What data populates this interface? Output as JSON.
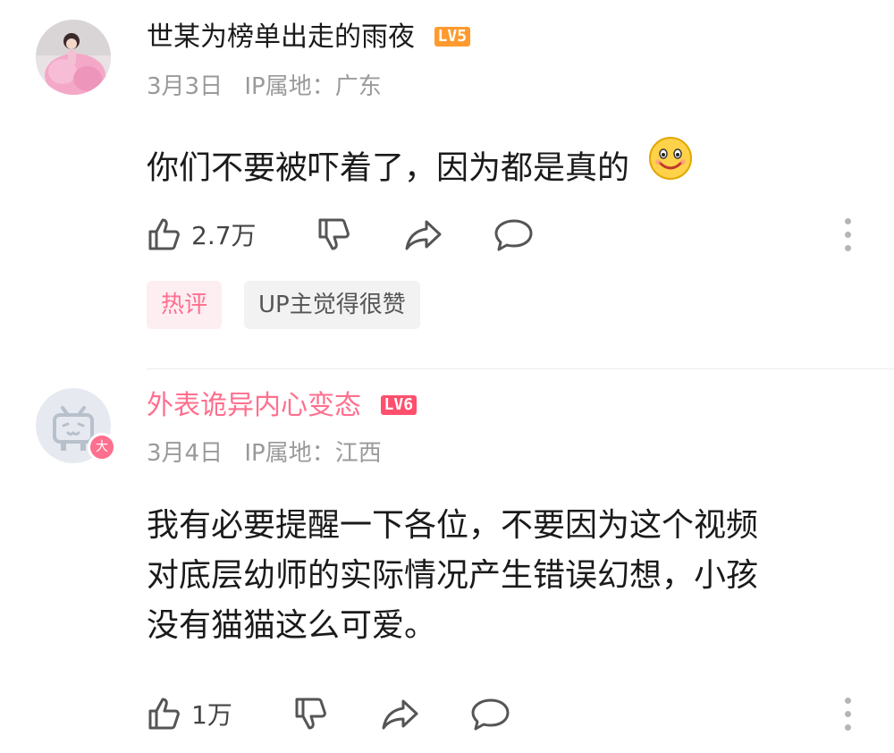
{
  "comments": [
    {
      "username": "世某为榜单出走的雨夜",
      "level": "LV5",
      "date": "3月3日",
      "ip_location": "IP属地：广东",
      "text": "你们不要被吓着了，因为都是真的",
      "emoji": "smile-emoji",
      "like_count": "2.7万",
      "tags": [
        "热评",
        "UP主觉得很赞"
      ],
      "colors": {
        "username": "#1a1a1a",
        "level_bg": "#ff9a2e"
      }
    },
    {
      "username": "外表诡异内心变态",
      "level": "LV6",
      "date": "3月4日",
      "ip_location": "IP属地：江西",
      "text_lines": [
        "我有必要提醒一下各位，不要因为这个视频",
        "对底层幼师的实际情况产生错误幻想，小孩",
        "没有猫猫这么可爱。"
      ],
      "avatar_badge": "大",
      "like_count": "1万",
      "colors": {
        "username": "#ff6f8e",
        "level_bg": "#ff4f6d"
      }
    }
  ],
  "icons": [
    "like-icon",
    "dislike-icon",
    "share-icon",
    "reply-icon",
    "more-icon"
  ]
}
